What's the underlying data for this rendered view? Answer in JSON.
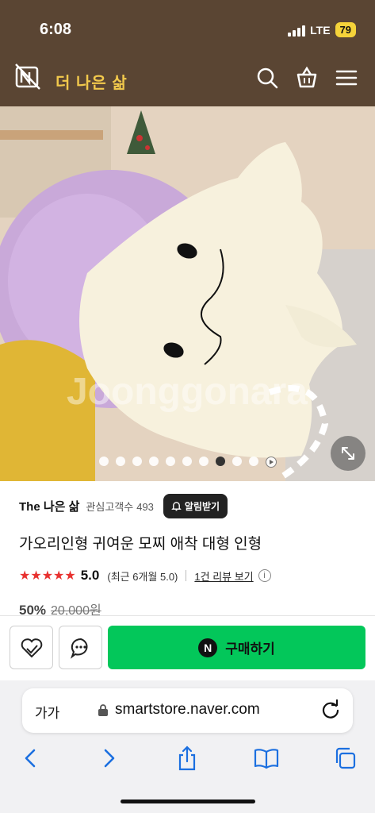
{
  "status_bar": {
    "time": "6:08",
    "network": "LTE",
    "battery": "79"
  },
  "store": {
    "name": "더 나은 삶",
    "logo_icon": "crossed-logo-icon"
  },
  "header_icons": [
    "search-icon",
    "shopping-bag-icon",
    "menu-icon"
  ],
  "gallery": {
    "total_dots": 10,
    "active_index": 7,
    "watermark": "Joonggonara"
  },
  "product": {
    "brand": "The 나은 삶",
    "followers_label": "관심고객수",
    "followers_count": "493",
    "notify_label": "알림받기",
    "title": "가오리인형 귀여운 모찌 애착 대형 인형",
    "stars": "★★★★★",
    "rating": "5.0",
    "recent_rating": "(최근 6개월 5.0)",
    "review_link": "1건 리뷰 보기",
    "info_symbol": "i",
    "discount": "50%",
    "original_price": "20,000원"
  },
  "purchase": {
    "buy_label": "구매하기",
    "naver_badge": "N"
  },
  "browser": {
    "text_size": "가가",
    "url": "smartstore.naver.com"
  },
  "colors": {
    "header_bg": "#5a4533",
    "store_name": "#f2c94c",
    "buy_green": "#03c75a",
    "star_red": "#e8312f"
  }
}
